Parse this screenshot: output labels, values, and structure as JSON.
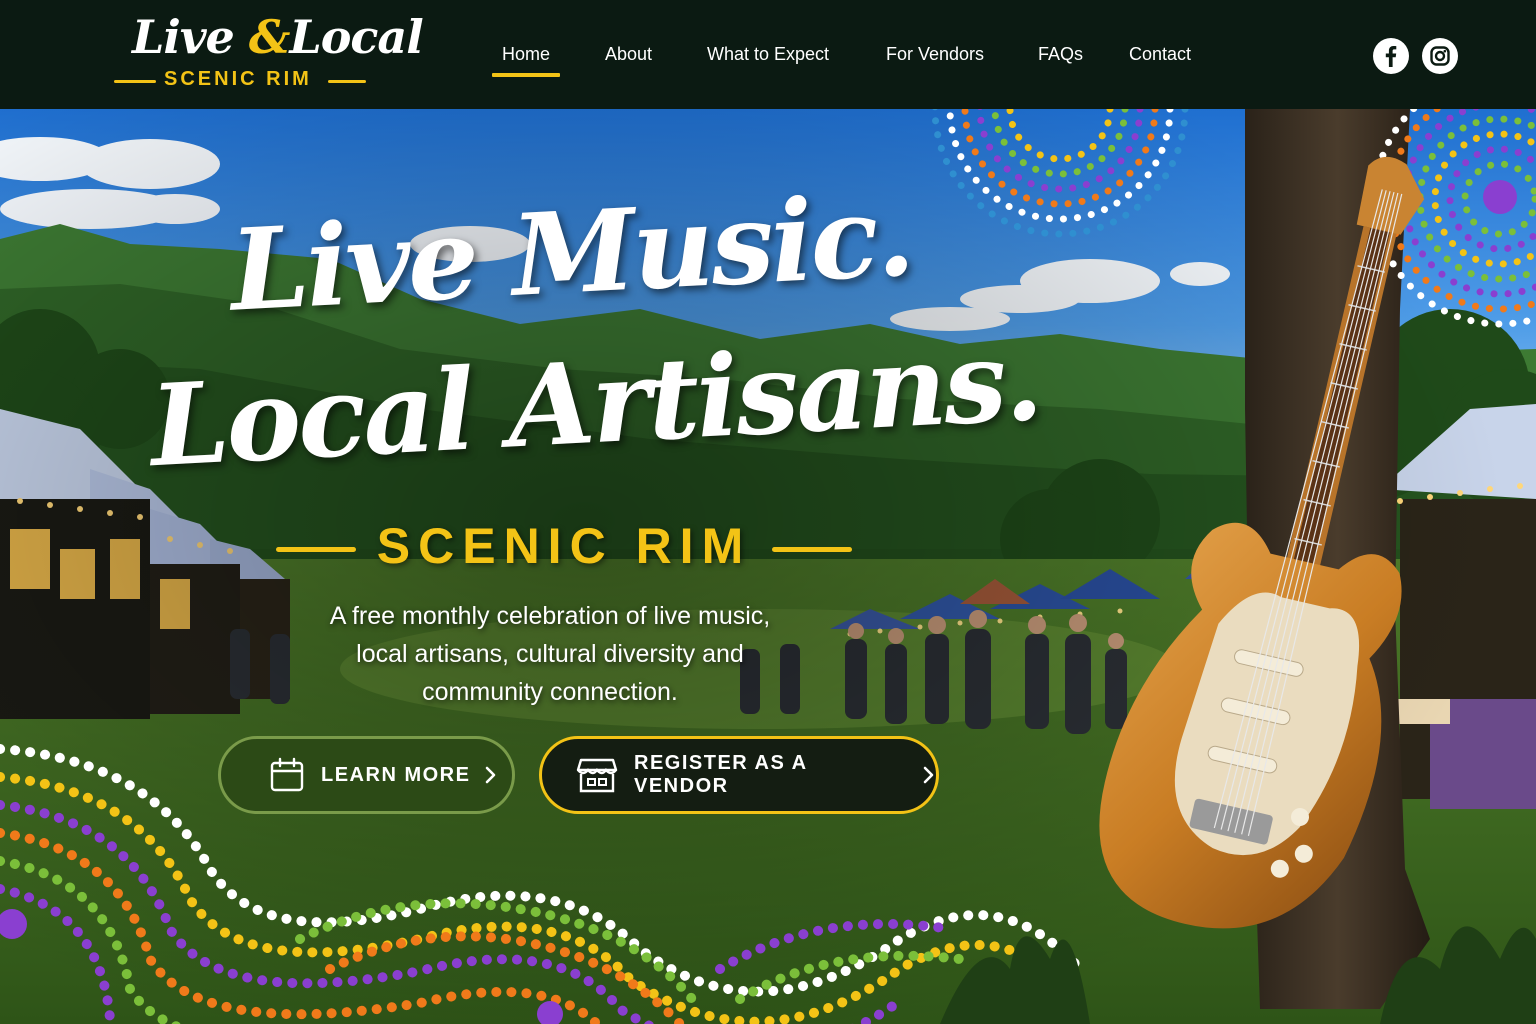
{
  "header": {
    "logo": {
      "script_left": "Live",
      "script_amp": "&",
      "script_right": "Local",
      "sub": "SCENIC RIM"
    },
    "nav": [
      {
        "label": "Home",
        "active": true
      },
      {
        "label": "About",
        "active": false
      },
      {
        "label": "What to Expect",
        "active": false
      },
      {
        "label": "For Vendors",
        "active": false
      },
      {
        "label": "FAQs",
        "active": false
      },
      {
        "label": "Contact",
        "active": false
      }
    ],
    "social": [
      {
        "icon": "facebook-icon"
      },
      {
        "icon": "instagram-icon"
      }
    ]
  },
  "hero": {
    "headline_line1": "Live Music.",
    "headline_line2": "Local Artisans.",
    "sub_brand": "SCENIC RIM",
    "tagline_line1": "A free monthly celebration of live music,",
    "tagline_line2": "local artisans, cultural diversity and",
    "tagline_line3": "community connection.",
    "buttons": {
      "learn_more": {
        "label": "LEARN MORE",
        "icon": "calendar-icon"
      },
      "register": {
        "label": "REGISTER AS A VENDOR",
        "icon": "market-stall-icon"
      }
    }
  },
  "colors": {
    "header_bg": "#0b1a12",
    "accent_yellow": "#f3c316",
    "learn_button_bg": "#2c4a16",
    "dot_purple": "#8a3fd0",
    "dot_orange": "#f07a1a",
    "dot_green": "#7bbf3a"
  }
}
